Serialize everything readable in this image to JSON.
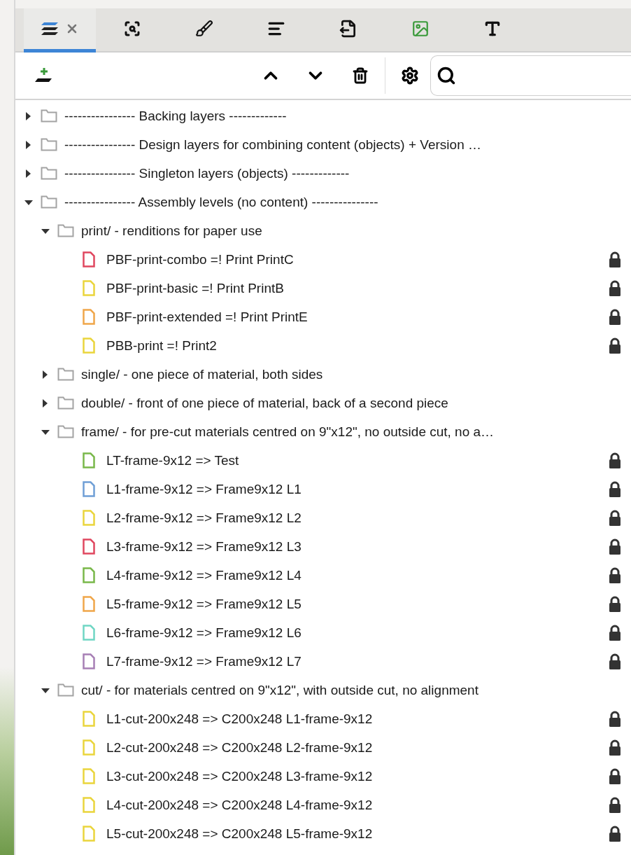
{
  "tabs": [
    {
      "kind": "layers",
      "selected": true,
      "closable": true
    },
    {
      "kind": "inspect",
      "selected": false,
      "closable": false
    },
    {
      "kind": "brush",
      "selected": false,
      "closable": false
    },
    {
      "kind": "align",
      "selected": false,
      "closable": false
    },
    {
      "kind": "export",
      "selected": false,
      "closable": false
    },
    {
      "kind": "image",
      "selected": false,
      "closable": false
    },
    {
      "kind": "text",
      "selected": false,
      "closable": false
    }
  ],
  "tree": [
    {
      "kind": "folder",
      "label": "---------------- Backing layers -------------",
      "expanded": false
    },
    {
      "kind": "folder",
      "label": "---------------- Design layers for combining content (objects) + Version …",
      "expanded": false
    },
    {
      "kind": "folder",
      "label": "---------------- Singleton layers (objects) -------------",
      "expanded": false
    },
    {
      "kind": "folder",
      "label": "---------------- Assembly levels (no content) ---------------",
      "expanded": true,
      "children": [
        {
          "kind": "folder",
          "label": "print/ - renditions for paper use",
          "expanded": true,
          "children": [
            {
              "kind": "file",
              "label": "PBF-print-combo =! Print PrintC",
              "color": "#e0475f",
              "locked": true
            },
            {
              "kind": "file",
              "label": "PBF-print-basic =! Print PrintB",
              "color": "#ead53c",
              "locked": true
            },
            {
              "kind": "file",
              "label": "PBF-print-extended =! Print PrintE",
              "color": "#f0a64a",
              "locked": true
            },
            {
              "kind": "file",
              "label": "PBB-print =! Print2",
              "color": "#ead53c",
              "locked": true
            }
          ]
        },
        {
          "kind": "folder",
          "label": "single/ - one piece of material, both sides",
          "expanded": false
        },
        {
          "kind": "folder",
          "label": "double/ - front of one piece of material, back of a second piece",
          "expanded": false
        },
        {
          "kind": "folder",
          "label": "frame/ - for pre-cut materials centred on 9\"x12\", no outside cut, no a…",
          "expanded": true,
          "children": [
            {
              "kind": "file",
              "label": "LT-frame-9x12 => Test",
              "color": "#79b84a",
              "locked": true
            },
            {
              "kind": "file",
              "label": "L1-frame-9x12 => Frame9x12 L1",
              "color": "#6f9fd6",
              "locked": true
            },
            {
              "kind": "file",
              "label": "L2-frame-9x12 => Frame9x12 L2",
              "color": "#ead53c",
              "locked": true
            },
            {
              "kind": "file",
              "label": "L3-frame-9x12 => Frame9x12 L3",
              "color": "#e0475f",
              "locked": true
            },
            {
              "kind": "file",
              "label": "L4-frame-9x12 => Frame9x12 L4",
              "color": "#79b84a",
              "locked": true
            },
            {
              "kind": "file",
              "label": "L5-frame-9x12 => Frame9x12 L5",
              "color": "#f0a64a",
              "locked": true
            },
            {
              "kind": "file",
              "label": "L6-frame-9x12 => Frame9x12 L6",
              "color": "#6fd6c4",
              "locked": true
            },
            {
              "kind": "file",
              "label": "L7-frame-9x12 => Frame9x12 L7",
              "color": "#a77fb5",
              "locked": true
            }
          ]
        },
        {
          "kind": "folder",
          "label": "cut/ - for materials centred on 9\"x12\", with outside cut, no alignment",
          "expanded": true,
          "children": [
            {
              "kind": "file",
              "label": "L1-cut-200x248 => C200x248 L1-frame-9x12",
              "color": "#ead53c",
              "locked": true
            },
            {
              "kind": "file",
              "label": "L2-cut-200x248 => C200x248 L2-frame-9x12",
              "color": "#ead53c",
              "locked": true
            },
            {
              "kind": "file",
              "label": "L3-cut-200x248 => C200x248 L3-frame-9x12",
              "color": "#ead53c",
              "locked": true
            },
            {
              "kind": "file",
              "label": "L4-cut-200x248 => C200x248 L4-frame-9x12",
              "color": "#ead53c",
              "locked": true
            },
            {
              "kind": "file",
              "label": "L5-cut-200x248 => C200x248 L5-frame-9x12",
              "color": "#ead53c",
              "locked": true
            }
          ]
        }
      ]
    }
  ]
}
